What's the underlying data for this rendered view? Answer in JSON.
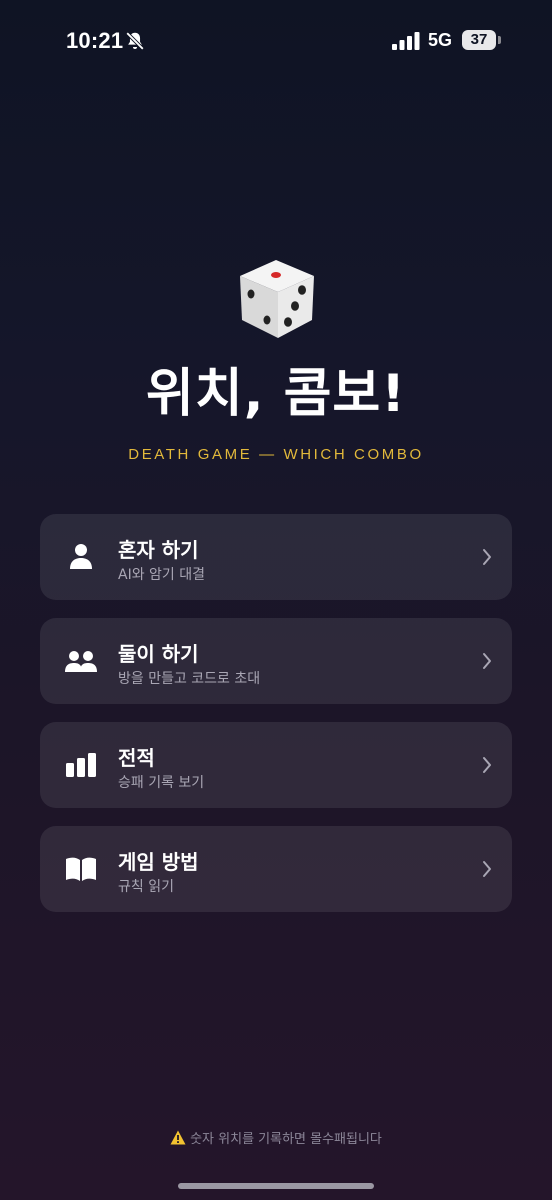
{
  "status_bar": {
    "time": "10:21",
    "network": "5G",
    "battery": "37",
    "icons": [
      "bell-slash-icon",
      "signal-icon",
      "battery-icon"
    ]
  },
  "hero": {
    "icon": "dice-icon",
    "title": "위치, 콤보!",
    "subtitle": "DEATH GAME — WHICH COMBO"
  },
  "menu": {
    "items": [
      {
        "icon": "person-icon",
        "title": "혼자 하기",
        "subtitle": "AI와 암기 대결"
      },
      {
        "icon": "people-icon",
        "title": "둘이 하기",
        "subtitle": "방을 만들고 코드로 초대"
      },
      {
        "icon": "bar-chart-icon",
        "title": "전적",
        "subtitle": "승패 기록 보기"
      },
      {
        "icon": "book-icon",
        "title": "게임 방법",
        "subtitle": "규칙 읽기"
      }
    ]
  },
  "footer": {
    "icon": "warning-icon",
    "warning": "숫자 위치를 기록하면 몰수패됩니다"
  },
  "colors": {
    "accent_gold": "#e2b93b",
    "card_bg": "rgba(255,255,255,0.085)",
    "subtext": "#a9a6b4"
  }
}
